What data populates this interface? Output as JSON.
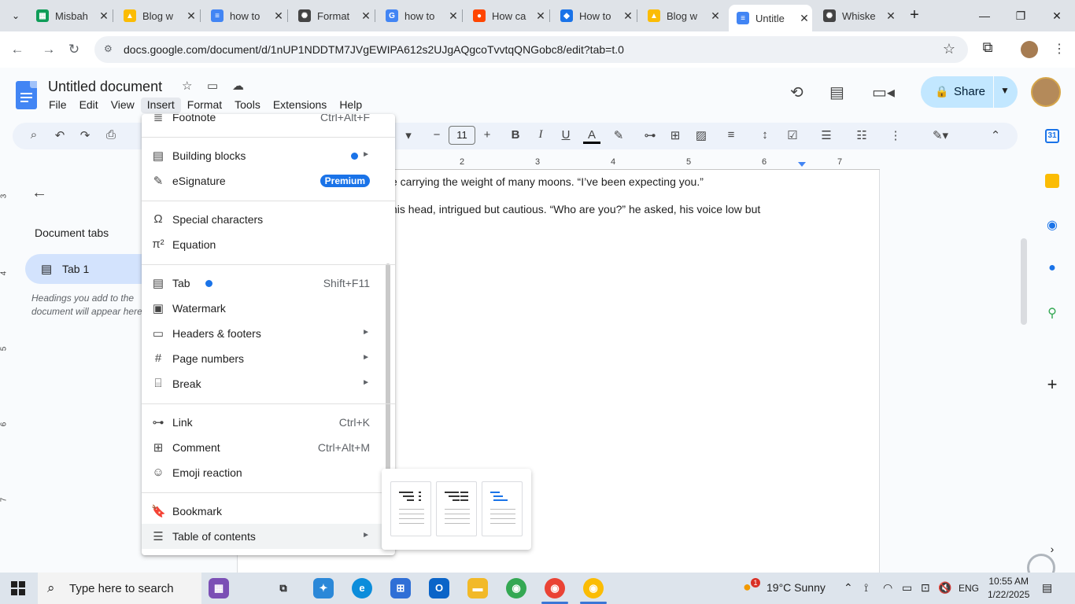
{
  "browser": {
    "tabs": [
      {
        "title": "Misbah",
        "color": "#0f9d58",
        "glyph": "▦"
      },
      {
        "title": "Blog w",
        "color": "#fbbc04",
        "glyph": "▲"
      },
      {
        "title": "how to",
        "color": "#4285f4",
        "glyph": "≡"
      },
      {
        "title": "Format",
        "color": "#444444",
        "glyph": "✺"
      },
      {
        "title": "how to",
        "color": "#4285f4",
        "glyph": "G"
      },
      {
        "title": "How ca",
        "color": "#ff4500",
        "glyph": "●"
      },
      {
        "title": "How to",
        "color": "#1a73e8",
        "glyph": "◆"
      },
      {
        "title": "Blog w",
        "color": "#fbbc04",
        "glyph": "▲"
      },
      {
        "title": "Untitle",
        "color": "#4285f4",
        "glyph": "≡"
      },
      {
        "title": "Whiske",
        "color": "#444444",
        "glyph": "✺"
      }
    ],
    "active_tab": 8,
    "url": "docs.google.com/document/d/1nUP1NDDTM7JVgEWIPA612s2UJgAQgcoTvvtqQNGobc8/edit?tab=t.0"
  },
  "doc": {
    "title": "Untitled document",
    "menus": [
      "File",
      "Edit",
      "View",
      "Insert",
      "Format",
      "Tools",
      "Extensions",
      "Help"
    ],
    "open_menu": "Insert",
    "share_label": "Share",
    "font_size": "11"
  },
  "panel": {
    "title": "Document tabs",
    "tab_name": "Tab 1",
    "hint": "Headings you add to the document will appear here."
  },
  "ruler": {
    "h_labels": [
      "2",
      "3",
      "4",
      "5",
      "6",
      "7"
    ],
    "v_labels": [
      "3",
      "4",
      "5",
      "6",
      "7"
    ]
  },
  "body_text": [
    "e carrying the weight of many moons. “I’ve been expecting you.”",
    "his head, intrigued but cautious. “Who are you?” he asked, his voice low but"
  ],
  "insert_menu": {
    "items": [
      {
        "label": "Footnote",
        "shortcut": "Ctrl+Alt+F",
        "icon": "footnote-icon",
        "glyph": "≣"
      },
      {
        "label": "Building blocks",
        "icon": "building-blocks-icon",
        "glyph": "▤",
        "dot": true,
        "submenu": true
      },
      {
        "label": "eSignature",
        "icon": "esignature-icon",
        "glyph": "✎",
        "badge": "Premium"
      },
      {
        "label": "Special characters",
        "icon": "omega-icon",
        "glyph": "Ω"
      },
      {
        "label": "Equation",
        "icon": "pi-icon",
        "glyph": "π²"
      },
      {
        "label": "Tab",
        "shortcut": "Shift+F11",
        "icon": "tab-icon",
        "glyph": "▤",
        "dot": true
      },
      {
        "label": "Watermark",
        "icon": "watermark-icon",
        "glyph": "▣"
      },
      {
        "label": "Headers & footers",
        "icon": "headers-footers-icon",
        "glyph": "▭",
        "submenu": true
      },
      {
        "label": "Page numbers",
        "icon": "hash-icon",
        "glyph": "#",
        "submenu": true
      },
      {
        "label": "Break",
        "icon": "break-icon",
        "glyph": "⌸",
        "submenu": true
      },
      {
        "label": "Link",
        "shortcut": "Ctrl+K",
        "icon": "link-icon",
        "glyph": "⊶"
      },
      {
        "label": "Comment",
        "shortcut": "Ctrl+Alt+M",
        "icon": "comment-icon",
        "glyph": "⊞"
      },
      {
        "label": "Emoji reaction",
        "icon": "emoji-icon",
        "glyph": "☺"
      },
      {
        "label": "Bookmark",
        "icon": "bookmark-icon",
        "glyph": "🔖"
      },
      {
        "label": "Table of contents",
        "icon": "toc-icon",
        "glyph": "☰",
        "submenu": true
      }
    ]
  },
  "taskbar": {
    "search_placeholder": "Type here to search",
    "weather_badge": "1",
    "weather": "19°C  Sunny",
    "lang": "ENG",
    "time": "10:55 AM",
    "date": "1/22/2025"
  }
}
